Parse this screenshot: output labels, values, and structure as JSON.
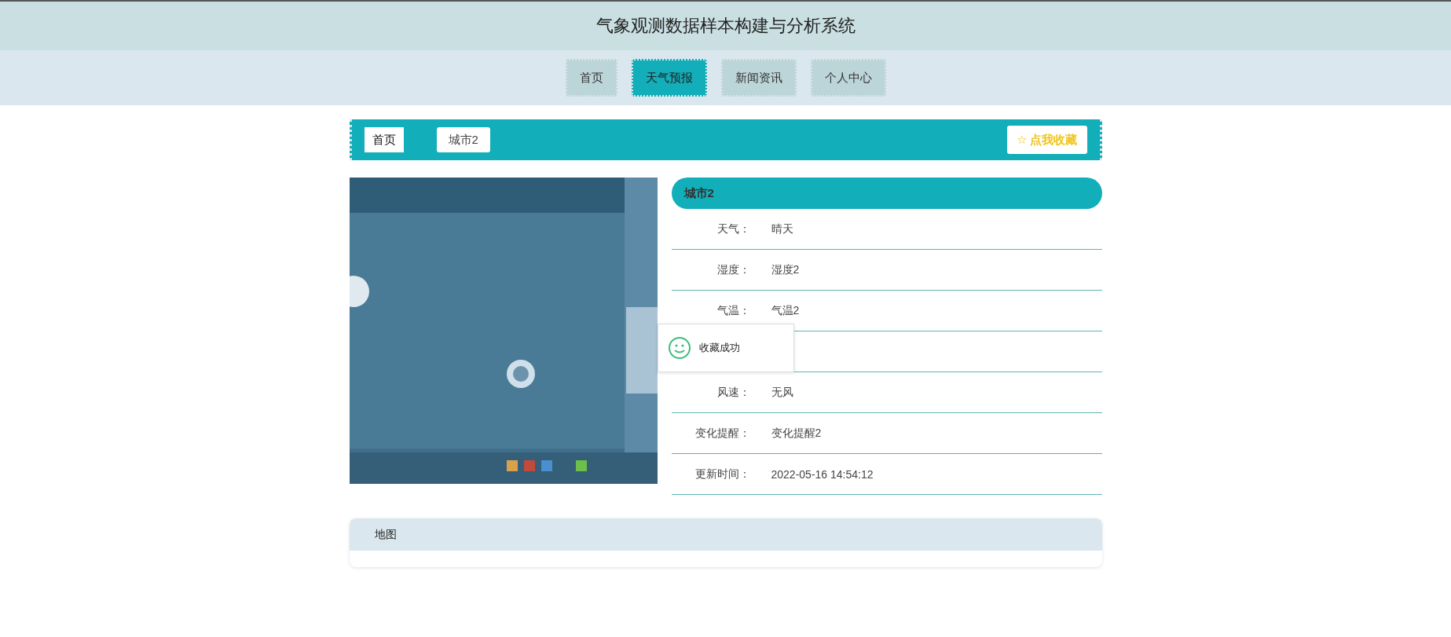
{
  "header": {
    "title": "气象观测数据样本构建与分析系统"
  },
  "nav": [
    {
      "label": "首页",
      "selected": false
    },
    {
      "label": "天气预报",
      "selected": true
    },
    {
      "label": "新闻资讯",
      "selected": false
    },
    {
      "label": "个人中心",
      "selected": false
    }
  ],
  "breadcrumb": [
    "首页",
    "城市2"
  ],
  "favorite_button": {
    "icon": "☆",
    "label": "点我收藏"
  },
  "detail": {
    "title": "城市2",
    "rows": [
      {
        "label": "天气：",
        "value": "晴天"
      },
      {
        "label": "湿度：",
        "value": "湿度2"
      },
      {
        "label": "气温：",
        "value": "气温2"
      },
      {
        "label": "风速：",
        "value": "无风"
      },
      {
        "label": "变化提醒：",
        "value": "变化提醒2"
      },
      {
        "label": "更新时间：",
        "value": "2022-05-16 14:54:12"
      }
    ]
  },
  "toast": {
    "text": "收藏成功"
  },
  "map_panel": {
    "title": "地图"
  }
}
